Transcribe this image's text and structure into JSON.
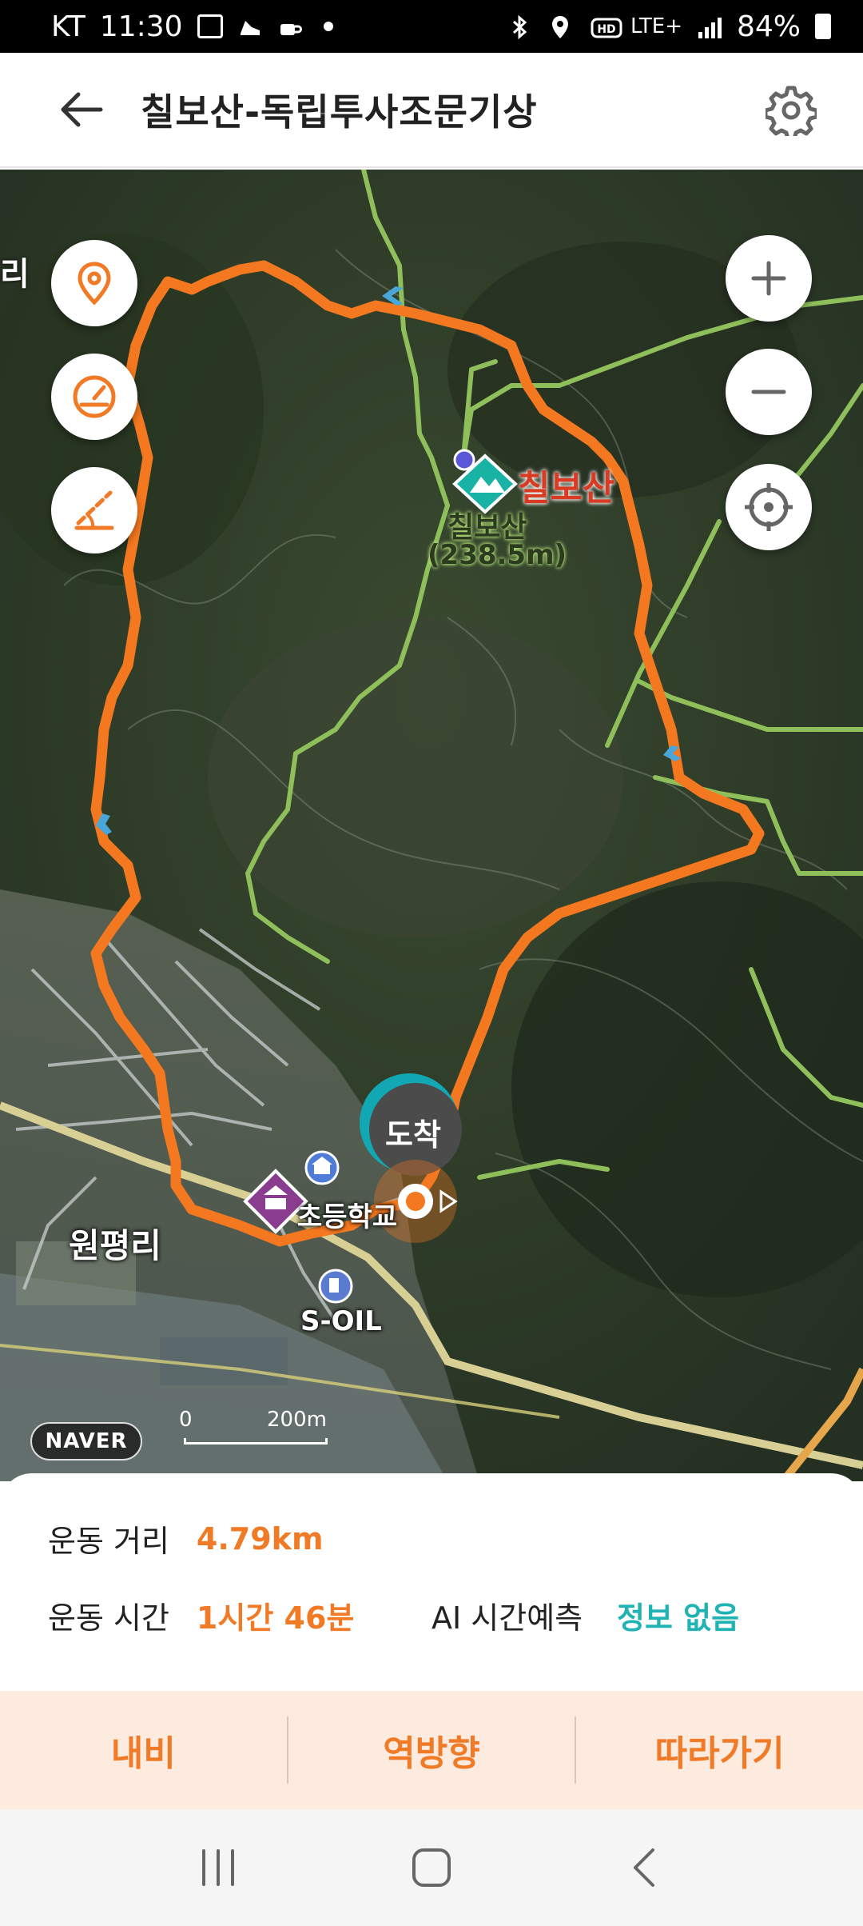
{
  "status_bar": {
    "carrier": "KT",
    "time": "11:30",
    "network": "LTE+",
    "battery": "84%"
  },
  "header": {
    "title": "칠보산-독립투사조문기상"
  },
  "map": {
    "peak_name": "칠보산",
    "peak_label": "칠보산",
    "peak_elevation": "(238.5m)",
    "village_label": "원평리",
    "edge_label": "리",
    "school_label": "초등학교",
    "gas_label": "S-OIL",
    "arrival_label": "도착",
    "provider_logo": "NAVER",
    "scale_zero": "0",
    "scale_distance": "200m",
    "colors": {
      "route": "#f4781f",
      "trail": "#8ebf5a",
      "accent": "#f07a26"
    }
  },
  "stats": {
    "distance_label": "운동 거리",
    "distance_value": "4.79km",
    "time_label": "운동 시간",
    "time_value": "1시간 46분",
    "ai_label": "AI 시간예측",
    "ai_value": "정보 없음"
  },
  "actions": {
    "navigate": "내비",
    "reverse": "역방향",
    "follow": "따라가기"
  },
  "icons": {
    "back": "arrow-left-icon",
    "settings": "gear-icon",
    "location_pin": "location-pin-icon",
    "speedometer": "speedometer-icon",
    "elevation": "elevation-icon",
    "zoom_in": "plus-icon",
    "zoom_out": "minus-icon",
    "my_location": "crosshair-icon"
  }
}
